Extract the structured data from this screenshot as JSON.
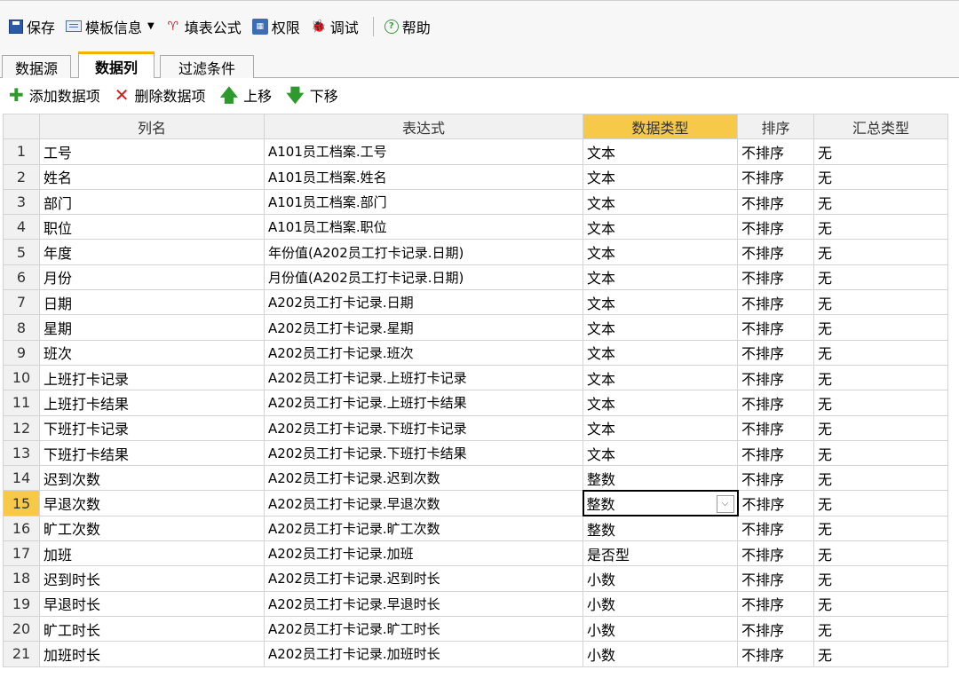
{
  "toolbar": {
    "save": "保存",
    "template_info": "模板信息",
    "fill_formula": "填表公式",
    "permission": "权限",
    "debug": "调试",
    "help": "帮助"
  },
  "tabs": [
    "数据源",
    "数据列",
    "过滤条件"
  ],
  "active_tab": "数据列",
  "actions": {
    "add": "添加数据项",
    "delete": "删除数据项",
    "up": "上移",
    "down": "下移"
  },
  "grid": {
    "columns": [
      "列名",
      "表达式",
      "数据类型",
      "排序",
      "汇总类型"
    ],
    "highlighted_column": "数据类型",
    "selected_row": 15,
    "rows": [
      {
        "n": "1",
        "name": "工号",
        "expr": "A101员工档案.工号",
        "type": "文本",
        "sort": "不排序",
        "agg": "无"
      },
      {
        "n": "2",
        "name": "姓名",
        "expr": "A101员工档案.姓名",
        "type": "文本",
        "sort": "不排序",
        "agg": "无"
      },
      {
        "n": "3",
        "name": "部门",
        "expr": "A101员工档案.部门",
        "type": "文本",
        "sort": "不排序",
        "agg": "无"
      },
      {
        "n": "4",
        "name": "职位",
        "expr": "A101员工档案.职位",
        "type": "文本",
        "sort": "不排序",
        "agg": "无"
      },
      {
        "n": "5",
        "name": "年度",
        "expr": "年份值(A202员工打卡记录.日期)",
        "type": "文本",
        "sort": "不排序",
        "agg": "无"
      },
      {
        "n": "6",
        "name": "月份",
        "expr": "月份值(A202员工打卡记录.日期)",
        "type": "文本",
        "sort": "不排序",
        "agg": "无"
      },
      {
        "n": "7",
        "name": "日期",
        "expr": "A202员工打卡记录.日期",
        "type": "文本",
        "sort": "不排序",
        "agg": "无"
      },
      {
        "n": "8",
        "name": "星期",
        "expr": "A202员工打卡记录.星期",
        "type": "文本",
        "sort": "不排序",
        "agg": "无"
      },
      {
        "n": "9",
        "name": "班次",
        "expr": "A202员工打卡记录.班次",
        "type": "文本",
        "sort": "不排序",
        "agg": "无"
      },
      {
        "n": "10",
        "name": "上班打卡记录",
        "expr": "A202员工打卡记录.上班打卡记录",
        "type": "文本",
        "sort": "不排序",
        "agg": "无"
      },
      {
        "n": "11",
        "name": "上班打卡结果",
        "expr": "A202员工打卡记录.上班打卡结果",
        "type": "文本",
        "sort": "不排序",
        "agg": "无"
      },
      {
        "n": "12",
        "name": "下班打卡记录",
        "expr": "A202员工打卡记录.下班打卡记录",
        "type": "文本",
        "sort": "不排序",
        "agg": "无"
      },
      {
        "n": "13",
        "name": "下班打卡结果",
        "expr": "A202员工打卡记录.下班打卡结果",
        "type": "文本",
        "sort": "不排序",
        "agg": "无"
      },
      {
        "n": "14",
        "name": "迟到次数",
        "expr": "A202员工打卡记录.迟到次数",
        "type": "整数",
        "sort": "不排序",
        "agg": "无"
      },
      {
        "n": "15",
        "name": "早退次数",
        "expr": "A202员工打卡记录.早退次数",
        "type": "整数",
        "sort": "不排序",
        "agg": "无"
      },
      {
        "n": "16",
        "name": "旷工次数",
        "expr": "A202员工打卡记录.旷工次数",
        "type": "整数",
        "sort": "不排序",
        "agg": "无"
      },
      {
        "n": "17",
        "name": "加班",
        "expr": "A202员工打卡记录.加班",
        "type": "是否型",
        "sort": "不排序",
        "agg": "无"
      },
      {
        "n": "18",
        "name": "迟到时长",
        "expr": "A202员工打卡记录.迟到时长",
        "type": "小数",
        "sort": "不排序",
        "agg": "无"
      },
      {
        "n": "19",
        "name": "早退时长",
        "expr": "A202员工打卡记录.早退时长",
        "type": "小数",
        "sort": "不排序",
        "agg": "无"
      },
      {
        "n": "20",
        "name": "旷工时长",
        "expr": "A202员工打卡记录.旷工时长",
        "type": "小数",
        "sort": "不排序",
        "agg": "无"
      },
      {
        "n": "21",
        "name": "加班时长",
        "expr": "A202员工打卡记录.加班时长",
        "type": "小数",
        "sort": "不排序",
        "agg": "无"
      }
    ]
  },
  "colors": {
    "header_highlight": "#f6c949",
    "active_tab_accent": "#f0b400",
    "add_icon": "#2e9a2e",
    "delete_icon": "#d01c1c"
  }
}
